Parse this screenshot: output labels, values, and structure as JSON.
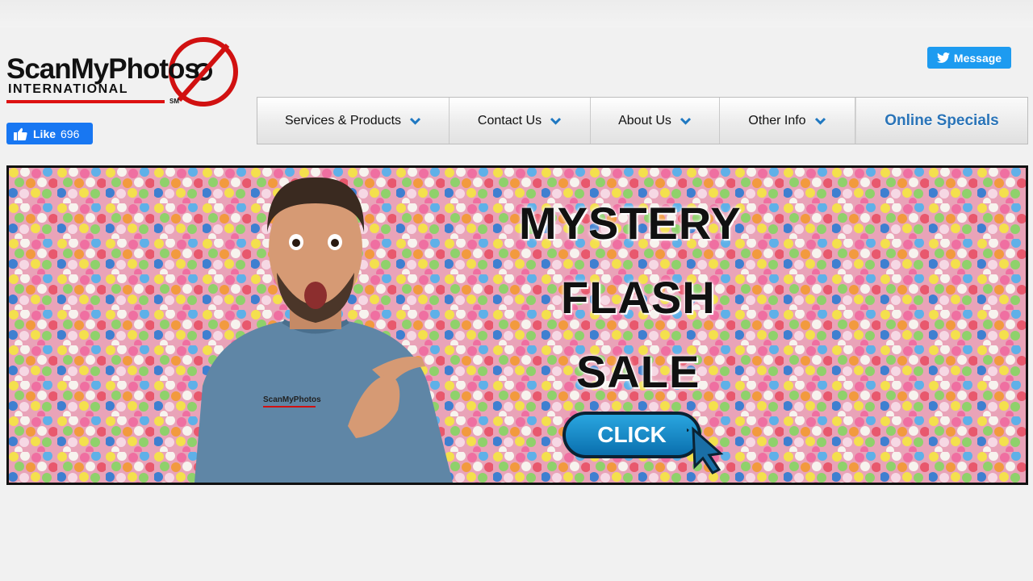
{
  "logo": {
    "name": "ScanMyPhotos",
    "subtitle": "INTERNATIONAL",
    "mark": "SM"
  },
  "facebook": {
    "like_label": "Like",
    "like_count": "696",
    "icon": "thumbs-up-icon"
  },
  "twitter": {
    "message_label": "Message",
    "icon": "twitter-bird-icon"
  },
  "nav": {
    "items": [
      {
        "label": "Services & Products",
        "icon": "chevron-down-icon"
      },
      {
        "label": "Contact Us",
        "icon": "chevron-down-icon"
      },
      {
        "label": "About Us",
        "icon": "chevron-down-icon"
      },
      {
        "label": "Other Info",
        "icon": "chevron-down-icon"
      }
    ],
    "special_label": "Online Specials"
  },
  "banner": {
    "line1": "MYSTERY",
    "line2": "FLASH",
    "line3": "SALE",
    "cta": "CLICK",
    "shirt_logo": "ScanMyPhotos"
  },
  "colors": {
    "facebook_blue": "#1877f2",
    "twitter_blue": "#1d9bf0",
    "accent_blue": "#2a74b8",
    "chevron_blue": "#1f78c1",
    "logo_red": "#d11111"
  }
}
